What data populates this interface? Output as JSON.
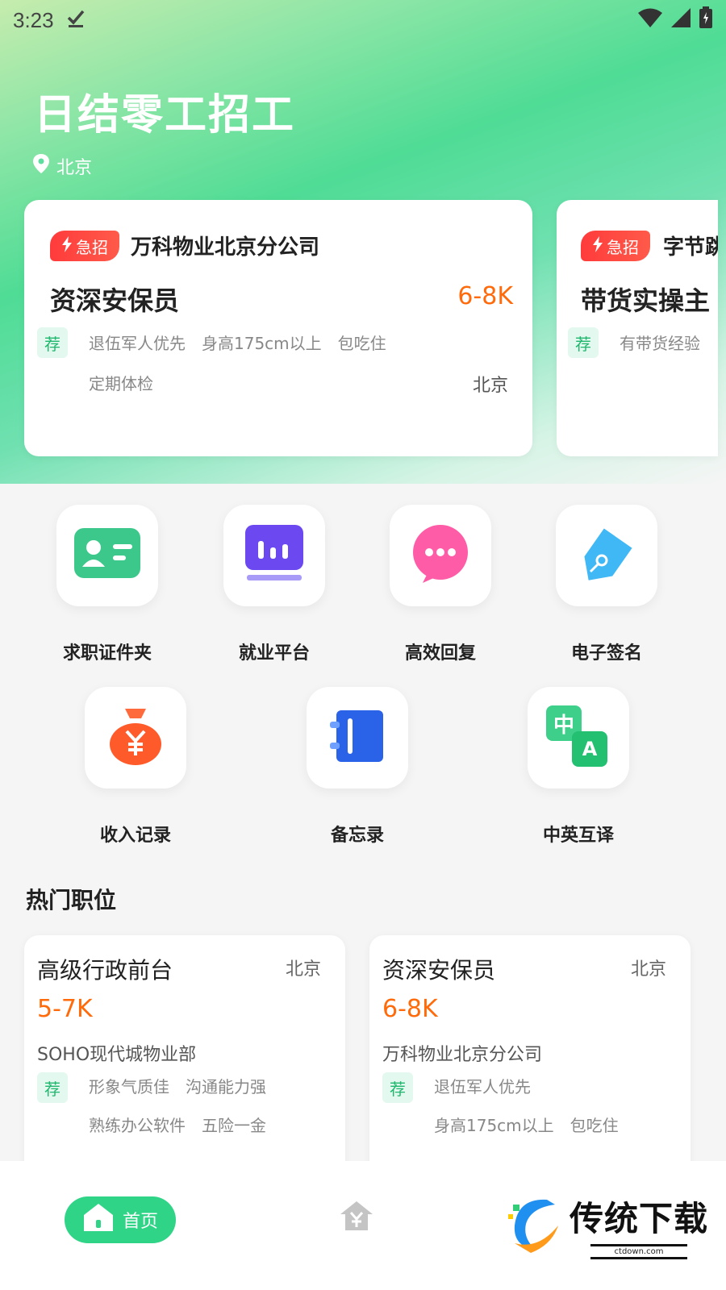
{
  "status_bar": {
    "time": "3:23"
  },
  "header": {
    "title": "日结零工招工",
    "location": "北京"
  },
  "featured": [
    {
      "badge": "急招",
      "company": "万科物业北京分公司",
      "title": "资深安保员",
      "salary": "6-8K",
      "rec": "荐",
      "tags_row1": [
        "退伍军人优先",
        "身高175cm以上",
        "包吃住"
      ],
      "tags_row2": [
        "定期体检"
      ],
      "city": "北京"
    },
    {
      "badge": "急招",
      "company": "字节跳",
      "title": "带货实操主",
      "rec": "荐",
      "tags_row1": [
        "有带货经验"
      ]
    }
  ],
  "tools": [
    {
      "label": "求职证件夹",
      "icon": "id-card-icon"
    },
    {
      "label": "就业平台",
      "icon": "platform-icon"
    },
    {
      "label": "高效回复",
      "icon": "chat-bubble-icon"
    },
    {
      "label": "电子签名",
      "icon": "sign-pen-icon"
    },
    {
      "label": "收入记录",
      "icon": "money-bag-icon"
    },
    {
      "label": "备忘录",
      "icon": "notebook-icon"
    },
    {
      "label": "中英互译",
      "icon": "translate-icon",
      "glyph_zh": "中",
      "glyph_en": "A"
    }
  ],
  "hot_section": {
    "title": "热门职位"
  },
  "hot_jobs": [
    {
      "title": "高级行政前台",
      "city": "北京",
      "salary": "5-7K",
      "company": "SOHO现代城物业部",
      "rec": "荐",
      "tags_row1": [
        "形象气质佳",
        "沟通能力强"
      ],
      "tags_row2": [
        "熟练办公软件",
        "五险一金"
      ]
    },
    {
      "title": "资深安保员",
      "city": "北京",
      "salary": "6-8K",
      "company": "万科物业北京分公司",
      "rec": "荐",
      "tags_row1": [
        "退伍军人优先"
      ],
      "tags_row2": [
        "身高175cm以上",
        "包吃住"
      ]
    }
  ],
  "bottom_nav": {
    "home": "首页",
    "income_icon": "yen-house-icon"
  },
  "watermark": {
    "main": "传统下载",
    "sub": "ctdown.com"
  },
  "colors": {
    "accent": "#2fd487",
    "salary": "#ff6a0a",
    "urgent": "#ff3b3b"
  }
}
